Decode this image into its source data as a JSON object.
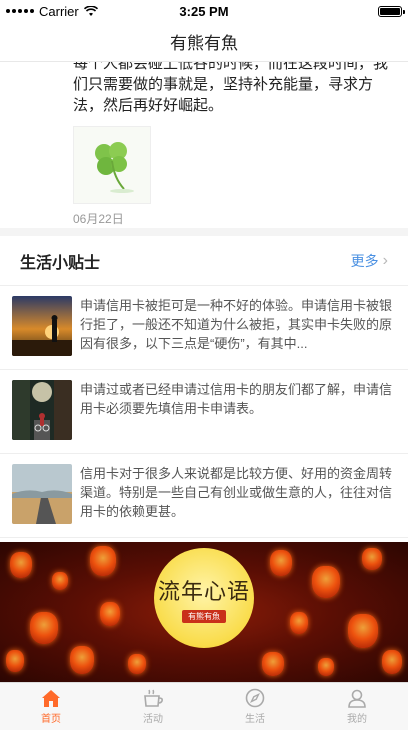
{
  "status_bar": {
    "carrier": "Carrier",
    "time": "3:25 PM"
  },
  "nav": {
    "title": "有熊有魚"
  },
  "post": {
    "text": "每个人都会碰上低谷的时候，而在这段时间，我们只需要做的事就是，坚持补充能量，寻求方法，然后再好好崛起。",
    "image_icon": "clover-icon",
    "date": "06月22日"
  },
  "tips_section": {
    "title": "生活小贴士",
    "more_label": "更多"
  },
  "tips": [
    {
      "text": "申请信用卡被拒可是一种不好的体验。申请信用卡被银行拒了，一般还不知道为什么被拒，其实申卡失败的原因有很多，以下三点是“硬伤”，有其中...",
      "thumb": "sunset-person-thumb"
    },
    {
      "text": "申请过或者已经申请过信用卡的朋友们都了解，申请信用卡必须要先填信用卡申请表。",
      "thumb": "street-cyclist-thumb"
    },
    {
      "text": "信用卡对于很多人来说都是比较方便、好用的资金周转渠道。特别是一些自己有创业或做生意的人，往往对信用卡的依赖更甚。",
      "thumb": "road-landscape-thumb"
    }
  ],
  "banner": {
    "title": "流年心语",
    "tag": "有熊有魚"
  },
  "tabs": [
    {
      "label": "首页",
      "icon": "home-icon",
      "active": true
    },
    {
      "label": "活动",
      "icon": "coffee-cup-icon",
      "active": false
    },
    {
      "label": "生活",
      "icon": "compass-icon",
      "active": false
    },
    {
      "label": "我的",
      "icon": "user-icon",
      "active": false
    }
  ],
  "colors": {
    "accent": "#ff6a2a",
    "link": "#4a90e2"
  }
}
